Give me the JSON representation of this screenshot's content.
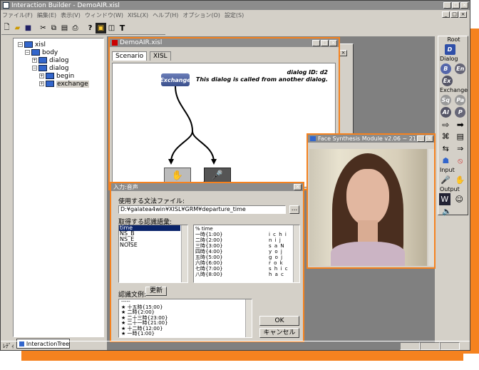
{
  "app": {
    "title": "Interaction Builder - DemoAIR.xisl"
  },
  "menu": [
    "ファイル(F)",
    "編集(E)",
    "表示(V)",
    "ウィンドウ(W)",
    "XISL(X)",
    "ヘルプ(H)",
    "オプション(O)",
    "設定(S)"
  ],
  "tree": {
    "nodes": [
      "xisl",
      "body",
      "dialog",
      "dialog",
      "begin",
      "exchange"
    ],
    "tab": "InteractionTree"
  },
  "scenario": {
    "title": "DemoAIR.xisl",
    "tabs": [
      "Scenario",
      "XISL"
    ],
    "node_label": "Exchange",
    "dialog_id": "dialog ID: d2",
    "dialog_desc": "This dialog is called from another dialog."
  },
  "voice": {
    "title": "入力:音声",
    "grammar_label": "使用する文法ファイル:",
    "grammar_path": "D:¥galatea4win¥XISL¥GRM¥departure_time",
    "browse": "...",
    "vocab_label": "取得する認識語彙:",
    "vocab": [
      "time",
      "NS_B",
      "NS_E",
      "NOISE"
    ],
    "grammar_lines": [
      "% time",
      "一時{1:00}",
      "二時{2:00}",
      "三時{3:00}",
      "四時{4:00}",
      "五時{5:00}",
      "六時{6:00}",
      "七時{7:00}",
      "八時{8:00}"
    ],
    "readings": [
      "",
      "i c h i",
      "n i j",
      "s a N",
      "y o j",
      "g o j",
      "r o k",
      "s h i c",
      "h a c"
    ],
    "examples_label": "認識文例:",
    "update": "更新",
    "examples": [
      "-----",
      "★ 十五時{15:00}",
      "★ 二時{2:00}",
      "★ 二十三時{23:00}",
      "★ 二十一時{21:00}",
      "★ 十二時{12:00}",
      "★ 一時{1:00}"
    ],
    "ok": "OK",
    "cancel": "キャンセル"
  },
  "face": {
    "title": "Face Synthesis Module v2.06 ~ 21"
  },
  "palette": {
    "sections": [
      "Root",
      "Dialog",
      "Exchange",
      "Input",
      "Output"
    ]
  },
  "status": {
    "text": "ﾚﾃﾞｨ"
  },
  "colors": {
    "accent": "#f5821f",
    "titlebar": "#8c8c8c",
    "desktop": "#808080"
  }
}
